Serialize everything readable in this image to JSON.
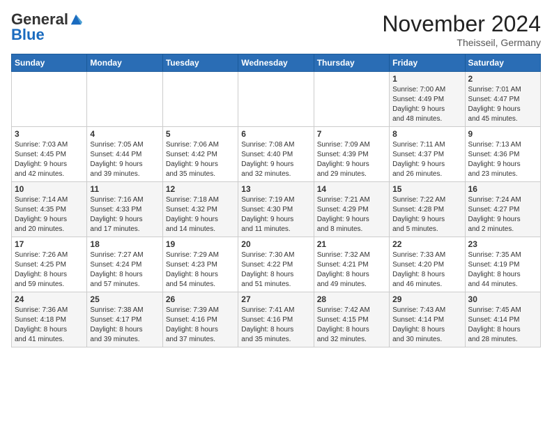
{
  "header": {
    "logo_general": "General",
    "logo_blue": "Blue",
    "month_title": "November 2024",
    "location": "Theisseil, Germany"
  },
  "days_of_week": [
    "Sunday",
    "Monday",
    "Tuesday",
    "Wednesday",
    "Thursday",
    "Friday",
    "Saturday"
  ],
  "weeks": [
    [
      {
        "day": "",
        "info": ""
      },
      {
        "day": "",
        "info": ""
      },
      {
        "day": "",
        "info": ""
      },
      {
        "day": "",
        "info": ""
      },
      {
        "day": "",
        "info": ""
      },
      {
        "day": "1",
        "info": "Sunrise: 7:00 AM\nSunset: 4:49 PM\nDaylight: 9 hours\nand 48 minutes."
      },
      {
        "day": "2",
        "info": "Sunrise: 7:01 AM\nSunset: 4:47 PM\nDaylight: 9 hours\nand 45 minutes."
      }
    ],
    [
      {
        "day": "3",
        "info": "Sunrise: 7:03 AM\nSunset: 4:45 PM\nDaylight: 9 hours\nand 42 minutes."
      },
      {
        "day": "4",
        "info": "Sunrise: 7:05 AM\nSunset: 4:44 PM\nDaylight: 9 hours\nand 39 minutes."
      },
      {
        "day": "5",
        "info": "Sunrise: 7:06 AM\nSunset: 4:42 PM\nDaylight: 9 hours\nand 35 minutes."
      },
      {
        "day": "6",
        "info": "Sunrise: 7:08 AM\nSunset: 4:40 PM\nDaylight: 9 hours\nand 32 minutes."
      },
      {
        "day": "7",
        "info": "Sunrise: 7:09 AM\nSunset: 4:39 PM\nDaylight: 9 hours\nand 29 minutes."
      },
      {
        "day": "8",
        "info": "Sunrise: 7:11 AM\nSunset: 4:37 PM\nDaylight: 9 hours\nand 26 minutes."
      },
      {
        "day": "9",
        "info": "Sunrise: 7:13 AM\nSunset: 4:36 PM\nDaylight: 9 hours\nand 23 minutes."
      }
    ],
    [
      {
        "day": "10",
        "info": "Sunrise: 7:14 AM\nSunset: 4:35 PM\nDaylight: 9 hours\nand 20 minutes."
      },
      {
        "day": "11",
        "info": "Sunrise: 7:16 AM\nSunset: 4:33 PM\nDaylight: 9 hours\nand 17 minutes."
      },
      {
        "day": "12",
        "info": "Sunrise: 7:18 AM\nSunset: 4:32 PM\nDaylight: 9 hours\nand 14 minutes."
      },
      {
        "day": "13",
        "info": "Sunrise: 7:19 AM\nSunset: 4:30 PM\nDaylight: 9 hours\nand 11 minutes."
      },
      {
        "day": "14",
        "info": "Sunrise: 7:21 AM\nSunset: 4:29 PM\nDaylight: 9 hours\nand 8 minutes."
      },
      {
        "day": "15",
        "info": "Sunrise: 7:22 AM\nSunset: 4:28 PM\nDaylight: 9 hours\nand 5 minutes."
      },
      {
        "day": "16",
        "info": "Sunrise: 7:24 AM\nSunset: 4:27 PM\nDaylight: 9 hours\nand 2 minutes."
      }
    ],
    [
      {
        "day": "17",
        "info": "Sunrise: 7:26 AM\nSunset: 4:25 PM\nDaylight: 8 hours\nand 59 minutes."
      },
      {
        "day": "18",
        "info": "Sunrise: 7:27 AM\nSunset: 4:24 PM\nDaylight: 8 hours\nand 57 minutes."
      },
      {
        "day": "19",
        "info": "Sunrise: 7:29 AM\nSunset: 4:23 PM\nDaylight: 8 hours\nand 54 minutes."
      },
      {
        "day": "20",
        "info": "Sunrise: 7:30 AM\nSunset: 4:22 PM\nDaylight: 8 hours\nand 51 minutes."
      },
      {
        "day": "21",
        "info": "Sunrise: 7:32 AM\nSunset: 4:21 PM\nDaylight: 8 hours\nand 49 minutes."
      },
      {
        "day": "22",
        "info": "Sunrise: 7:33 AM\nSunset: 4:20 PM\nDaylight: 8 hours\nand 46 minutes."
      },
      {
        "day": "23",
        "info": "Sunrise: 7:35 AM\nSunset: 4:19 PM\nDaylight: 8 hours\nand 44 minutes."
      }
    ],
    [
      {
        "day": "24",
        "info": "Sunrise: 7:36 AM\nSunset: 4:18 PM\nDaylight: 8 hours\nand 41 minutes."
      },
      {
        "day": "25",
        "info": "Sunrise: 7:38 AM\nSunset: 4:17 PM\nDaylight: 8 hours\nand 39 minutes."
      },
      {
        "day": "26",
        "info": "Sunrise: 7:39 AM\nSunset: 4:16 PM\nDaylight: 8 hours\nand 37 minutes."
      },
      {
        "day": "27",
        "info": "Sunrise: 7:41 AM\nSunset: 4:16 PM\nDaylight: 8 hours\nand 35 minutes."
      },
      {
        "day": "28",
        "info": "Sunrise: 7:42 AM\nSunset: 4:15 PM\nDaylight: 8 hours\nand 32 minutes."
      },
      {
        "day": "29",
        "info": "Sunrise: 7:43 AM\nSunset: 4:14 PM\nDaylight: 8 hours\nand 30 minutes."
      },
      {
        "day": "30",
        "info": "Sunrise: 7:45 AM\nSunset: 4:14 PM\nDaylight: 8 hours\nand 28 minutes."
      }
    ]
  ]
}
